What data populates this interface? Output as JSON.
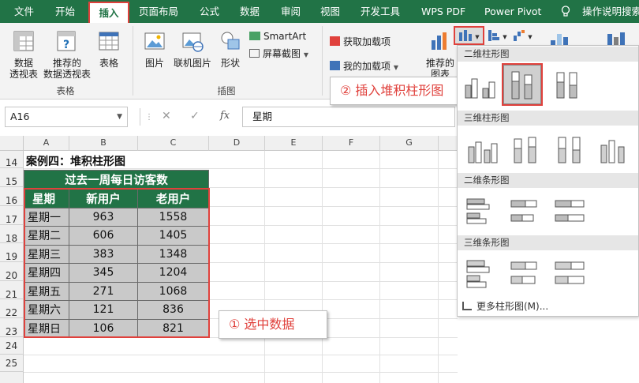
{
  "menu": {
    "tabs": [
      "文件",
      "开始",
      "插入",
      "页面布局",
      "公式",
      "数据",
      "审阅",
      "视图",
      "开发工具",
      "WPS PDF",
      "Power Pivot"
    ],
    "active_tab": "插入",
    "tell_me": "操作说明搜索"
  },
  "ribbon": {
    "pivot_table": "数据\n透视表",
    "recommended_pivot": "推荐的\n数据透视表",
    "table": "表格",
    "table_group": "表格",
    "picture": "图片",
    "online_picture": "联机图片",
    "shapes": "形状",
    "smartart": "SmartArt",
    "screenshot": "屏幕截图",
    "illustrations_group": "插图",
    "get_addins": "获取加载项",
    "my_addins": "我的加载项",
    "recommended_charts": "推荐的\n图表"
  },
  "formula_bar": {
    "name_box": "A16",
    "formula": "星期"
  },
  "sheet": {
    "columns": [
      "A",
      "B",
      "C",
      "D",
      "E",
      "F",
      "G"
    ],
    "rows": [
      "14",
      "15",
      "16",
      "17",
      "18",
      "19",
      "20",
      "21",
      "22",
      "23",
      "24",
      "25"
    ],
    "case_title": "案例四：堆积柱形图",
    "table_title": "过去一周每日访客数",
    "headers": [
      "星期",
      "新用户",
      "老用户"
    ],
    "data": [
      [
        "星期一",
        "963",
        "1558"
      ],
      [
        "星期二",
        "606",
        "1405"
      ],
      [
        "星期三",
        "383",
        "1348"
      ],
      [
        "星期四",
        "345",
        "1204"
      ],
      [
        "星期五",
        "271",
        "1068"
      ],
      [
        "星期六",
        "121",
        "836"
      ],
      [
        "星期日",
        "106",
        "821"
      ]
    ]
  },
  "callouts": {
    "step1": "① 选中数据",
    "step2": "② 插入堆积柱形图"
  },
  "chart_menu": {
    "sections": [
      "二维柱形图",
      "三维柱形图",
      "二维条形图",
      "三维条形图"
    ],
    "more": "更多柱形图(M)..."
  },
  "colors": {
    "excel_green": "#217346",
    "highlight_red": "#e0413c",
    "selection_gray": "#c9c9c9"
  }
}
